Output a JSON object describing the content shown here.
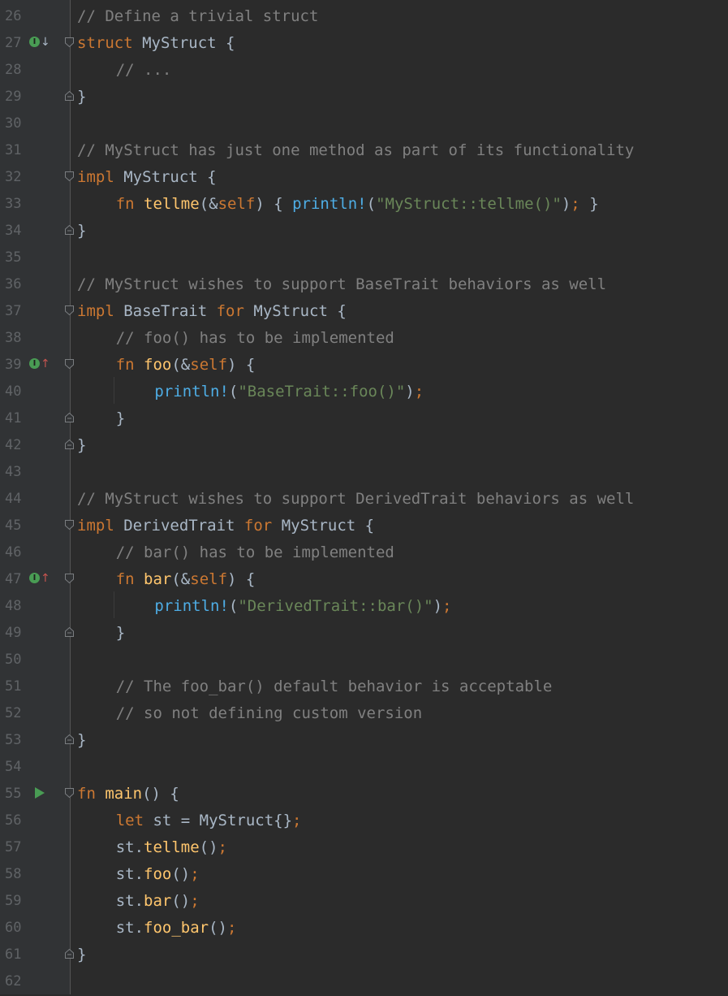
{
  "editor": {
    "language": "Rust",
    "colors": {
      "background": "#2b2b2b",
      "gutter": "#313335",
      "line_number": "#606366",
      "comment": "#808080",
      "keyword": "#cc7832",
      "function": "#ffc66d",
      "macro": "#4eade5",
      "string": "#6a8759",
      "plain": "#a9b7c6",
      "run_icon": "#499c54"
    },
    "lines": [
      {
        "num": "26",
        "indent": 0,
        "tokens": [
          {
            "t": "// Define a trivial struct",
            "c": "comment"
          }
        ]
      },
      {
        "num": "27",
        "indent": 0,
        "icon": "implemented-down-icon",
        "fold": "start",
        "tokens": [
          {
            "t": "struct",
            "c": "kw"
          },
          {
            "t": " MyStruct {",
            "c": "plain"
          }
        ]
      },
      {
        "num": "28",
        "indent": 1,
        "tokens": [
          {
            "t": "// ...",
            "c": "comment"
          }
        ]
      },
      {
        "num": "29",
        "indent": 0,
        "fold": "end",
        "tokens": [
          {
            "t": "}",
            "c": "plain"
          }
        ]
      },
      {
        "num": "30",
        "indent": 0,
        "tokens": []
      },
      {
        "num": "31",
        "indent": 0,
        "tokens": [
          {
            "t": "// MyStruct has just one method as part of its functionality",
            "c": "comment"
          }
        ]
      },
      {
        "num": "32",
        "indent": 0,
        "fold": "start",
        "tokens": [
          {
            "t": "impl",
            "c": "kw"
          },
          {
            "t": " MyStruct {",
            "c": "plain"
          }
        ]
      },
      {
        "num": "33",
        "indent": 1,
        "tokens": [
          {
            "t": "fn",
            "c": "kw"
          },
          {
            "t": " ",
            "c": "plain"
          },
          {
            "t": "tellme",
            "c": "fn"
          },
          {
            "t": "(&",
            "c": "plain"
          },
          {
            "t": "self",
            "c": "kw"
          },
          {
            "t": ") { ",
            "c": "plain"
          },
          {
            "t": "println!",
            "c": "macro"
          },
          {
            "t": "(",
            "c": "plain"
          },
          {
            "t": "\"MyStruct::tellme()\"",
            "c": "str"
          },
          {
            "t": ")",
            "c": "plain"
          },
          {
            "t": ";",
            "c": "kw"
          },
          {
            "t": " }",
            "c": "plain"
          }
        ]
      },
      {
        "num": "34",
        "indent": 0,
        "fold": "end",
        "tokens": [
          {
            "t": "}",
            "c": "plain"
          }
        ]
      },
      {
        "num": "35",
        "indent": 0,
        "tokens": []
      },
      {
        "num": "36",
        "indent": 0,
        "tokens": [
          {
            "t": "// MyStruct wishes to support BaseTrait behaviors as well",
            "c": "comment"
          }
        ]
      },
      {
        "num": "37",
        "indent": 0,
        "fold": "start",
        "tokens": [
          {
            "t": "impl",
            "c": "kw"
          },
          {
            "t": " BaseTrait ",
            "c": "plain"
          },
          {
            "t": "for",
            "c": "kw"
          },
          {
            "t": " MyStruct {",
            "c": "plain"
          }
        ]
      },
      {
        "num": "38",
        "indent": 1,
        "tokens": [
          {
            "t": "// foo() has to be implemented",
            "c": "comment"
          }
        ]
      },
      {
        "num": "39",
        "indent": 1,
        "icon": "implementing-up-icon",
        "fold": "start",
        "tokens": [
          {
            "t": "fn",
            "c": "kw"
          },
          {
            "t": " ",
            "c": "plain"
          },
          {
            "t": "foo",
            "c": "fn"
          },
          {
            "t": "(&",
            "c": "plain"
          },
          {
            "t": "self",
            "c": "kw"
          },
          {
            "t": ") {",
            "c": "plain"
          }
        ]
      },
      {
        "num": "40",
        "indent": 2,
        "tokens": [
          {
            "t": "println!",
            "c": "macro"
          },
          {
            "t": "(",
            "c": "plain"
          },
          {
            "t": "\"BaseTrait::foo()\"",
            "c": "str"
          },
          {
            "t": ")",
            "c": "plain"
          },
          {
            "t": ";",
            "c": "kw"
          }
        ]
      },
      {
        "num": "41",
        "indent": 1,
        "fold": "end",
        "tokens": [
          {
            "t": "}",
            "c": "plain"
          }
        ]
      },
      {
        "num": "42",
        "indent": 0,
        "fold": "end",
        "tokens": [
          {
            "t": "}",
            "c": "plain"
          }
        ]
      },
      {
        "num": "43",
        "indent": 0,
        "tokens": []
      },
      {
        "num": "44",
        "indent": 0,
        "tokens": [
          {
            "t": "// MyStruct wishes to support DerivedTrait behaviors as well",
            "c": "comment"
          }
        ]
      },
      {
        "num": "45",
        "indent": 0,
        "fold": "start",
        "tokens": [
          {
            "t": "impl",
            "c": "kw"
          },
          {
            "t": " DerivedTrait ",
            "c": "plain"
          },
          {
            "t": "for",
            "c": "kw"
          },
          {
            "t": " MyStruct {",
            "c": "plain"
          }
        ]
      },
      {
        "num": "46",
        "indent": 1,
        "tokens": [
          {
            "t": "// bar() has to be implemented",
            "c": "comment"
          }
        ]
      },
      {
        "num": "47",
        "indent": 1,
        "icon": "implementing-up-icon",
        "fold": "start",
        "tokens": [
          {
            "t": "fn",
            "c": "kw"
          },
          {
            "t": " ",
            "c": "plain"
          },
          {
            "t": "bar",
            "c": "fn"
          },
          {
            "t": "(&",
            "c": "plain"
          },
          {
            "t": "self",
            "c": "kw"
          },
          {
            "t": ") {",
            "c": "plain"
          }
        ]
      },
      {
        "num": "48",
        "indent": 2,
        "tokens": [
          {
            "t": "println!",
            "c": "macro"
          },
          {
            "t": "(",
            "c": "plain"
          },
          {
            "t": "\"DerivedTrait::bar()\"",
            "c": "str"
          },
          {
            "t": ")",
            "c": "plain"
          },
          {
            "t": ";",
            "c": "kw"
          }
        ]
      },
      {
        "num": "49",
        "indent": 1,
        "fold": "end",
        "tokens": [
          {
            "t": "}",
            "c": "plain"
          }
        ]
      },
      {
        "num": "50",
        "indent": 0,
        "tokens": []
      },
      {
        "num": "51",
        "indent": 1,
        "tokens": [
          {
            "t": "// The foo_bar() default behavior is acceptable",
            "c": "comment"
          }
        ]
      },
      {
        "num": "52",
        "indent": 1,
        "tokens": [
          {
            "t": "// so not defining custom version",
            "c": "comment"
          }
        ]
      },
      {
        "num": "53",
        "indent": 0,
        "fold": "end",
        "tokens": [
          {
            "t": "}",
            "c": "plain"
          }
        ]
      },
      {
        "num": "54",
        "indent": 0,
        "tokens": []
      },
      {
        "num": "55",
        "indent": 0,
        "icon": "run-icon",
        "fold": "start",
        "tokens": [
          {
            "t": "fn",
            "c": "kw"
          },
          {
            "t": " ",
            "c": "plain"
          },
          {
            "t": "main",
            "c": "fn"
          },
          {
            "t": "() {",
            "c": "plain"
          }
        ]
      },
      {
        "num": "56",
        "indent": 1,
        "tokens": [
          {
            "t": "let",
            "c": "kw"
          },
          {
            "t": " st = MyStruct{}",
            "c": "plain"
          },
          {
            "t": ";",
            "c": "kw"
          }
        ]
      },
      {
        "num": "57",
        "indent": 1,
        "tokens": [
          {
            "t": "st.",
            "c": "plain"
          },
          {
            "t": "tellme",
            "c": "fn"
          },
          {
            "t": "()",
            "c": "plain"
          },
          {
            "t": ";",
            "c": "kw"
          }
        ]
      },
      {
        "num": "58",
        "indent": 1,
        "tokens": [
          {
            "t": "st.",
            "c": "plain"
          },
          {
            "t": "foo",
            "c": "fn"
          },
          {
            "t": "()",
            "c": "plain"
          },
          {
            "t": ";",
            "c": "kw"
          }
        ]
      },
      {
        "num": "59",
        "indent": 1,
        "tokens": [
          {
            "t": "st.",
            "c": "plain"
          },
          {
            "t": "bar",
            "c": "fn"
          },
          {
            "t": "()",
            "c": "plain"
          },
          {
            "t": ";",
            "c": "kw"
          }
        ]
      },
      {
        "num": "60",
        "indent": 1,
        "tokens": [
          {
            "t": "st.",
            "c": "plain"
          },
          {
            "t": "foo_bar",
            "c": "fn"
          },
          {
            "t": "()",
            "c": "plain"
          },
          {
            "t": ";",
            "c": "kw"
          }
        ]
      },
      {
        "num": "61",
        "indent": 0,
        "fold": "end",
        "tokens": [
          {
            "t": "}",
            "c": "plain"
          }
        ]
      },
      {
        "num": "62",
        "indent": 0,
        "tokens": []
      }
    ]
  }
}
